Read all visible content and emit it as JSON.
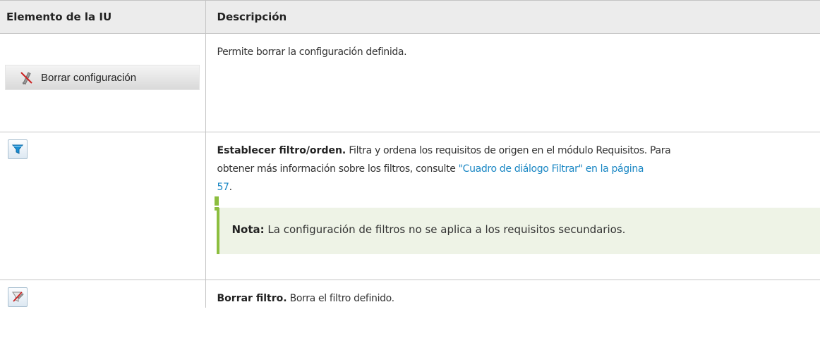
{
  "table": {
    "headers": [
      "Elemento de la IU",
      "Descripción"
    ],
    "rows": [
      {
        "ui_label": "Borrar configuración",
        "icon": "clear-settings-icon",
        "description": "Permite borrar la configuración definida."
      },
      {
        "icon": "funnel-filter-icon",
        "title": "Establecer filtro/orden.",
        "line1": "Filtra y ordena los requisitos de origen en el módulo Requisitos. Para",
        "line2_text": "obtener más información sobre los filtros, consulte ",
        "link_part1": "\"Cuadro de diálogo Filtrar\" en la página",
        "link_part2": "57",
        "after_link": ".",
        "note": {
          "label": "Nota:",
          "text": " La configuración de filtros no se aplica a los requisitos secundarios.",
          "icon": "exclamation-icon"
        }
      },
      {
        "icon": "clear-filter-icon",
        "title": "Borrar filtro.",
        "description": " Borra el filtro definido."
      }
    ]
  },
  "colors": {
    "header_bg": "#ececec",
    "link": "#1a87c4",
    "note_bg": "#eef3e6",
    "note_border": "#8cbe3f"
  }
}
